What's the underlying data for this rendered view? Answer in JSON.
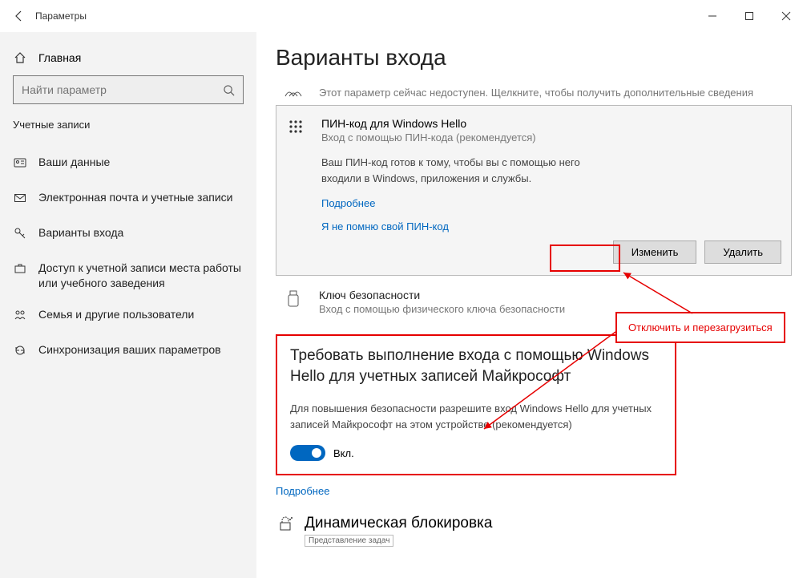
{
  "titlebar": {
    "title": "Параметры"
  },
  "sidebar": {
    "home": "Главная",
    "search_placeholder": "Найти параметр",
    "group": "Учетные записи",
    "items": [
      "Ваши данные",
      "Электронная почта и учетные записи",
      "Варианты входа",
      "Доступ к учетной записи места работы или учебного заведения",
      "Семья и другие пользователи",
      "Синхронизация ваших параметров"
    ]
  },
  "page_title": "Варианты входа",
  "option_unavail": {
    "sub": "Этот параметр сейчас недоступен. Щелкните, чтобы получить дополнительные сведения"
  },
  "pin": {
    "title": "ПИН-код для Windows Hello",
    "sub": "Вход с помощью ПИН-кода (рекомендуется)",
    "body": "Ваш ПИН-код готов к тому, чтобы вы с помощью него входили в Windows, приложения и службы.",
    "link_more": "Подробнее",
    "link_forgot": "Я не помню свой ПИН-код",
    "btn_change": "Изменить",
    "btn_remove": "Удалить"
  },
  "seckey": {
    "title": "Ключ безопасности",
    "sub": "Вход с помощью физического ключа безопасности"
  },
  "hello": {
    "title": "Требовать выполнение входа с помощью Windows Hello для учетных записей Майкрософт",
    "desc": "Для повышения безопасности разрешите вход Windows Hello для учетных записей Майкрософт на этом устройстве (рекомендуется)",
    "toggle_label": "Вкл.",
    "link_more": "Подробнее"
  },
  "dynamic": {
    "title": "Динамическая блокировка",
    "task": "Представление задач"
  },
  "annotation": {
    "callout": "Отключить и перезагрузиться"
  }
}
